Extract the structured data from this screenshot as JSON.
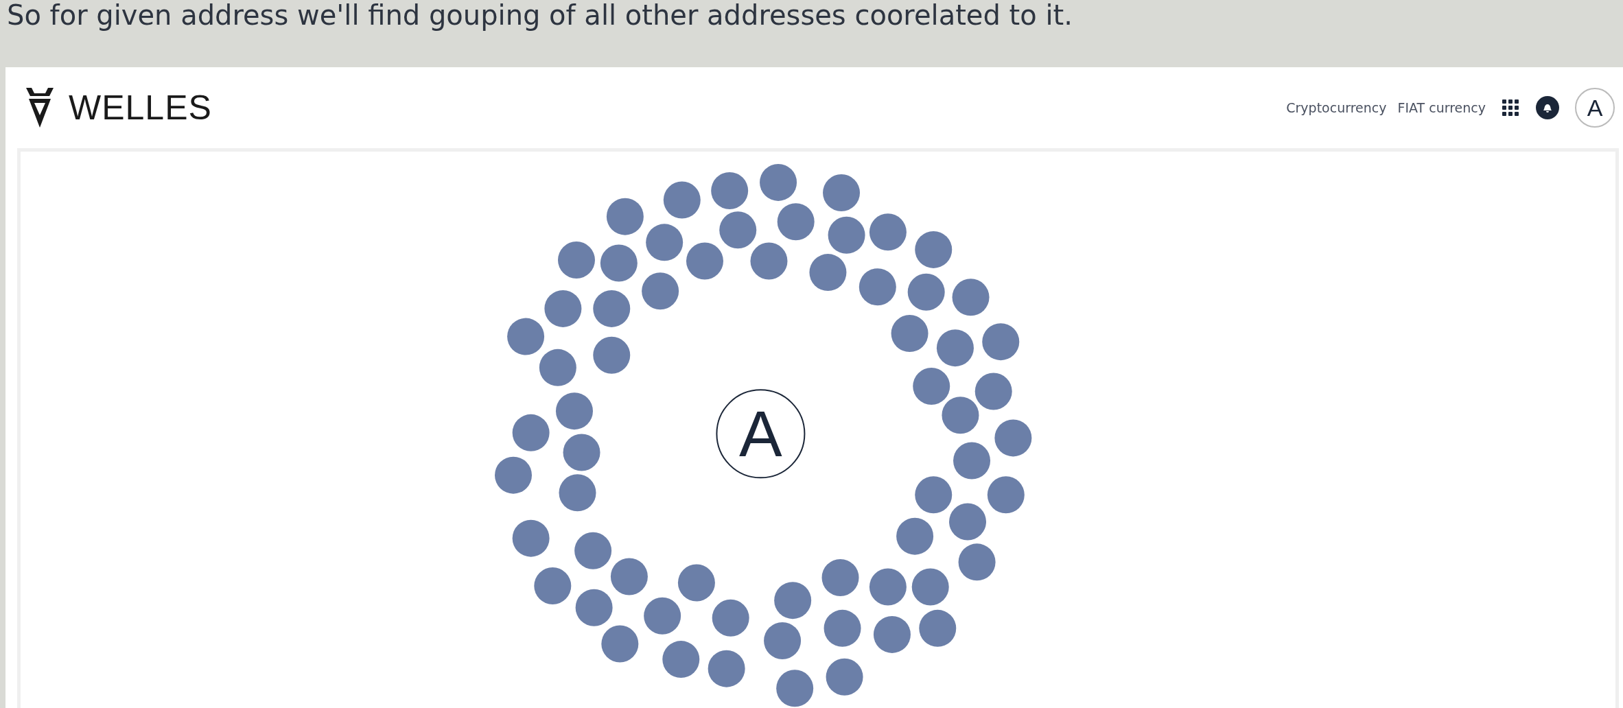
{
  "caption": "So for given  address we'll find gouping of all other addresses coorelated to it.",
  "header": {
    "brand": "WELLES",
    "nav": [
      {
        "label": "Cryptocurrency"
      },
      {
        "label": "FIAT currency"
      }
    ],
    "avatar": "A"
  },
  "graph": {
    "center_label": "A"
  }
}
